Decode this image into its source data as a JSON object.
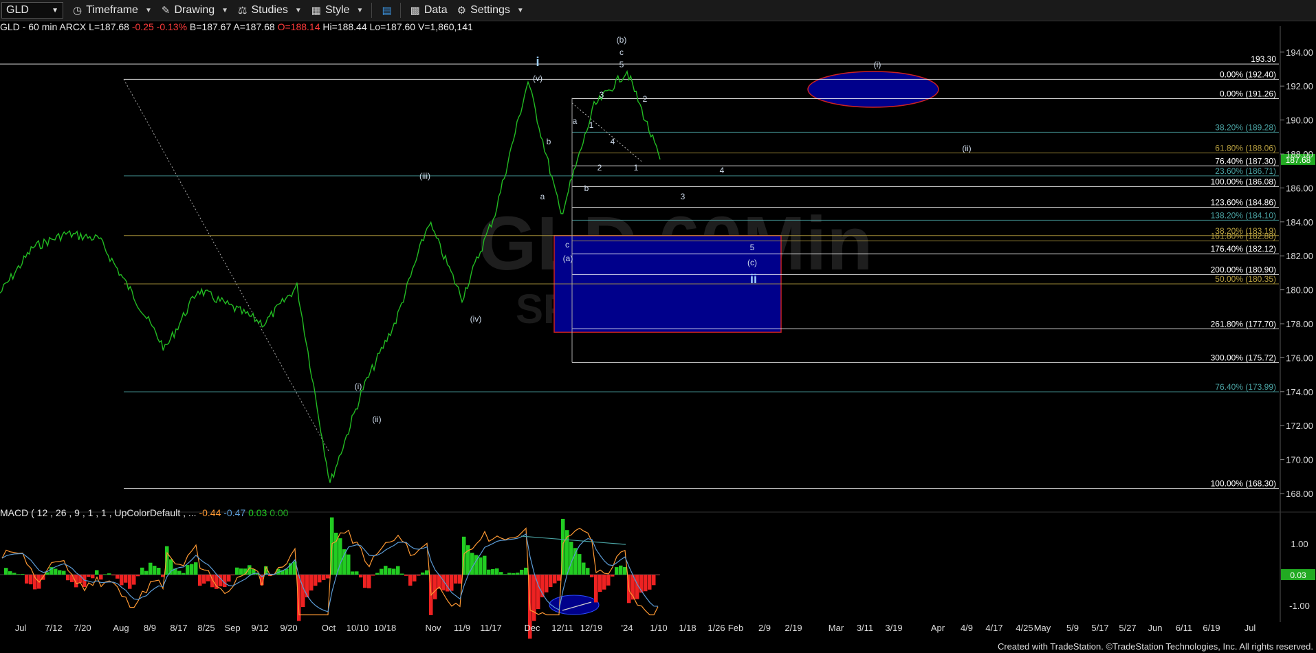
{
  "toolbar": {
    "symbol": "GLD",
    "items": [
      {
        "label": "Timeframe",
        "icon": "clock-icon"
      },
      {
        "label": "Drawing",
        "icon": "pencil-icon"
      },
      {
        "label": "Studies",
        "icon": "flask-icon"
      },
      {
        "label": "Style",
        "icon": "style-icon"
      },
      {
        "label": "",
        "icon": "layout-icon"
      },
      {
        "label": "Data",
        "icon": "bar-chart-icon"
      },
      {
        "label": "Settings",
        "icon": "gear-icon"
      }
    ]
  },
  "quote": {
    "symbol_line": "GLD - 60 min  ARCX",
    "last": "L=187.68",
    "change": "-0.25",
    "change_pct": "-0.13%",
    "bid": "B=187.67",
    "ask": "A=187.68",
    "open": "O=188.14",
    "high": "Hi=188.44",
    "low": "Lo=187.60",
    "volume": "V=1,860,141"
  },
  "macd_info": {
    "label": "MACD ( 12 , 26 , 9 , 1 , 1 , UpColorDefault , ...",
    "values": [
      "-0.44",
      "-0.47",
      "0.03",
      "0.00"
    ],
    "colors": [
      "#ff9933",
      "#5b9bd5",
      "#22cc22",
      "#22aa22"
    ]
  },
  "price_axis": {
    "ticks": [
      "194.00",
      "192.00",
      "190.00",
      "188.00",
      "186.00",
      "184.00",
      "182.00",
      "180.00",
      "178.00",
      "176.00",
      "174.00",
      "172.00",
      "170.00",
      "168.00"
    ],
    "current_price": "187.68",
    "current_color": "#22aa22"
  },
  "macd_axis": {
    "ticks": [
      "1.00",
      "-1.00"
    ],
    "current": "0.03"
  },
  "date_axis": {
    "labels": [
      "Jul",
      "7/12",
      "7/20",
      "Aug",
      "8/9",
      "8/17",
      "8/25",
      "Sep",
      "9/12",
      "9/20",
      "Oct",
      "10/10",
      "10/18",
      "Nov",
      "11/9",
      "11/17",
      "Dec",
      "12/11",
      "12/19",
      "'24",
      "1/10",
      "1/18",
      "1/26",
      "Feb",
      "2/9",
      "2/19",
      "Mar",
      "3/11",
      "3/19",
      "Apr",
      "4/9",
      "4/17",
      "4/25",
      "May",
      "5/9",
      "5/17",
      "5/27",
      "Jun",
      "6/11",
      "6/19",
      "Jul"
    ]
  },
  "levels": [
    {
      "label": "193.30",
      "color": "#ffffff"
    },
    {
      "label": "0.00% (192.40)",
      "color": "#ffffff"
    },
    {
      "label": "0.00% (191.26)",
      "color": "#ffffff"
    },
    {
      "label": "38.20% (189.28)",
      "color": "#4aa3a3"
    },
    {
      "label": "61.80% (188.06)",
      "color": "#b8a040"
    },
    {
      "label": "76.40% (187.30)",
      "color": "#ffffff"
    },
    {
      "label": "23.60% (186.71)",
      "color": "#4aa3a3"
    },
    {
      "label": "100.00% (186.08)",
      "color": "#ffffff"
    },
    {
      "label": "123.60% (184.86)",
      "color": "#ffffff"
    },
    {
      "label": "138.20% (184.10)",
      "color": "#4aa3a3"
    },
    {
      "label": "38.20% (183.19)",
      "color": "#b8a040"
    },
    {
      "label": "161.80% (182.88)",
      "color": "#b8a040"
    },
    {
      "label": "176.40% (182.12)",
      "color": "#ffffff"
    },
    {
      "label": "200.00% (180.90)",
      "color": "#ffffff"
    },
    {
      "label": "50.00% (180.35)",
      "color": "#b8a040"
    },
    {
      "label": "261.80% (177.70)",
      "color": "#ffffff"
    },
    {
      "label": "300.00% (175.72)",
      "color": "#ffffff"
    },
    {
      "label": "76.40% (173.99)",
      "color": "#4aa3a3"
    },
    {
      "label": "100.00% (168.30)",
      "color": "#ffffff"
    }
  ],
  "wave_labels": [
    "(b)",
    "c",
    "5",
    "i",
    "(v)",
    "3",
    "2",
    "a",
    "1",
    "b",
    "4",
    "2",
    "1",
    "b",
    "4",
    "3",
    "(iii)",
    "5",
    "(c)",
    "ii",
    "c",
    "(a)",
    "(iv)",
    "(i)",
    "(ii)",
    "(i)",
    "(ii)",
    "a"
  ],
  "watermark": {
    "text": "GLD 60Min",
    "sub": "SP"
  },
  "footer": "Created with TradeStation. ©TradeStation Technologies, Inc. All rights reserved.",
  "chart_data": {
    "type": "line",
    "title": "GLD - 60 min",
    "x_labels": [
      "Jul",
      "7/12",
      "7/20",
      "Aug",
      "8/9",
      "8/17",
      "8/25",
      "Sep",
      "9/12",
      "9/20",
      "Oct",
      "10/10",
      "10/18",
      "Nov",
      "11/9",
      "11/17",
      "Dec",
      "12/11",
      "12/19",
      "'24",
      "1/10"
    ],
    "series": [
      {
        "name": "GLD",
        "values": [
          179.8,
          182.5,
          183.3,
          183.0,
          179.8,
          176.5,
          180.0,
          179.0,
          178.0,
          180.2,
          168.6,
          174.2,
          178.2,
          184.0,
          179.5,
          184.5,
          192.3,
          184.4,
          190.8,
          192.9,
          187.68
        ]
      }
    ],
    "ylim": [
      167.0,
      195.0
    ],
    "macd": {
      "series": [
        "MACD",
        "Signal",
        "Histogram"
      ],
      "ylim": [
        -1.4,
        1.6
      ]
    },
    "grid": false
  },
  "colors": {
    "price": "#22bb22",
    "box_fill": "#00008b",
    "box_border": "#cc2222",
    "hist_pos": "#22cc22",
    "hist_neg": "#ee2222"
  }
}
